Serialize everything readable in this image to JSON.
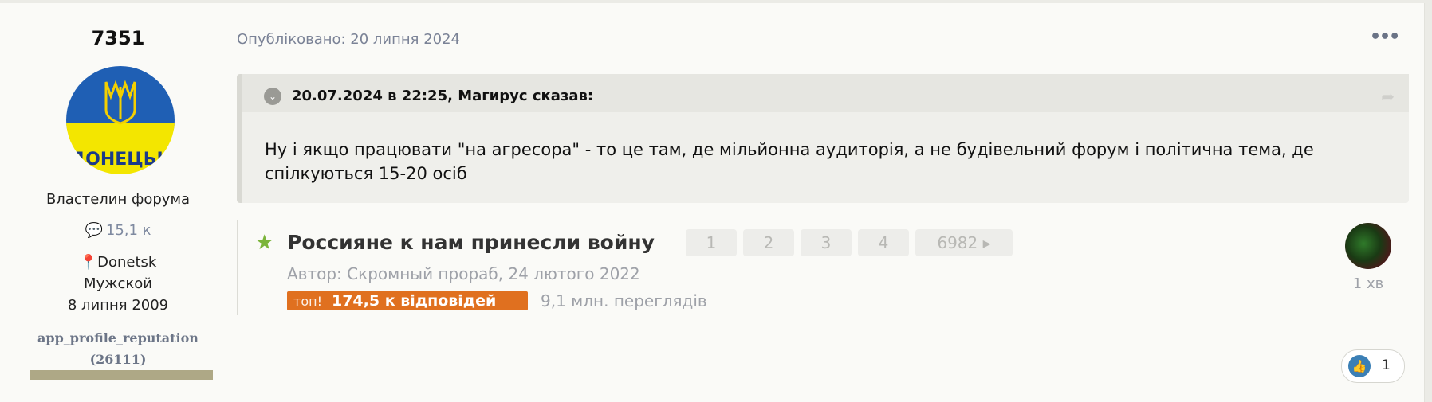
{
  "author": {
    "name": "7351",
    "avatar_text": "ДОНЕЦЬК",
    "rank": "Властелин форума",
    "posts_count": "15,1 к",
    "location": "Donetsk",
    "gender": "Мужской",
    "joined": "8 липня 2009",
    "reputation_label": "app_profile_reputation",
    "reputation_value": "(26111)"
  },
  "post": {
    "published": "Опубліковано: 20 липня 2024",
    "more_icon": "•••"
  },
  "quote": {
    "cite": "20.07.2024 в 22:25, Магирус сказав:",
    "body": "Ну і якщо працювати \"на агресора\" - то це там, де мільйонна аудиторія, а не будівельний форум і політична тема, де спілкуються 15-20 осіб"
  },
  "topic": {
    "title": "Россияне к нам принесли войну",
    "pages": [
      "1",
      "2",
      "3",
      "4",
      "6982 ▸"
    ],
    "author_line": "Автор: Скромный прораб, 24 лютого 2022",
    "hot_label": "топ!",
    "replies": "174,5 к відповідей",
    "views": "9,1 млн. переглядів",
    "last_time": "1 хв"
  },
  "reactions": {
    "count": "1"
  },
  "colors": {
    "accent": "#3b7fb5",
    "hot": "#e0701f",
    "star": "#7bb43a",
    "reputation_bar": "#aea886"
  }
}
